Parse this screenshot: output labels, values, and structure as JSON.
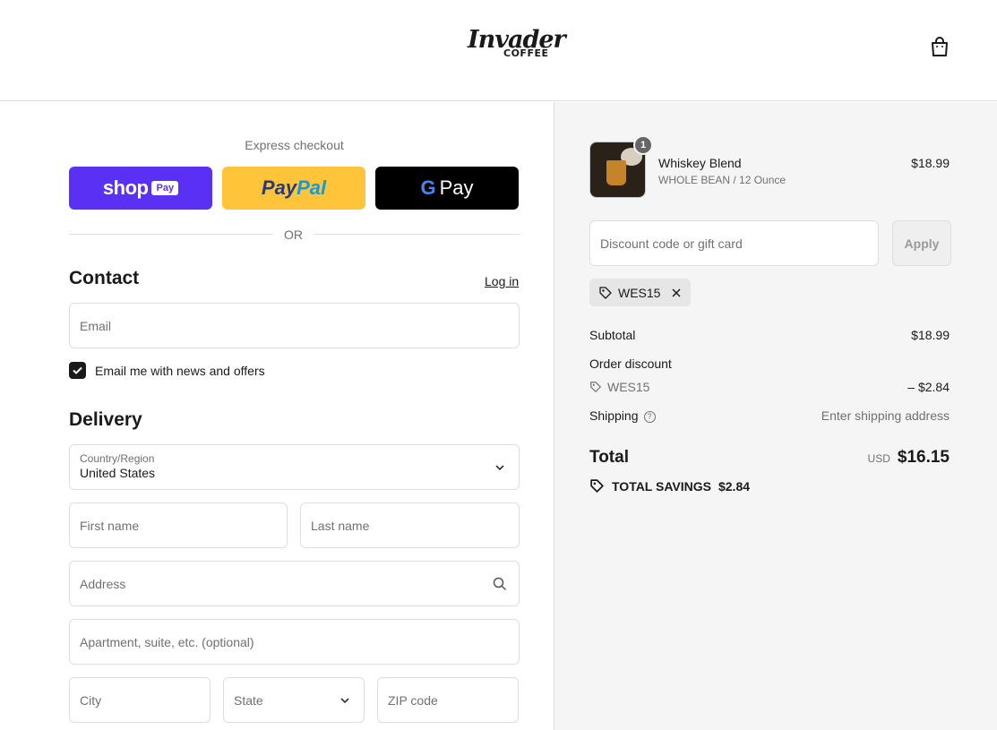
{
  "header": {
    "logo_main": "Invader",
    "logo_sub": "COFFEE",
    "cart_icon": "shopping-bag-icon"
  },
  "express": {
    "title": "Express checkout",
    "shop_pay": {
      "word": "shop",
      "badge": "Pay"
    },
    "paypal": {
      "a": "Pay",
      "b": "Pal"
    },
    "gpay": {
      "g": "G",
      "text": "Pay"
    },
    "or": "OR"
  },
  "contact": {
    "heading": "Contact",
    "login": "Log in",
    "email_placeholder": "Email",
    "newsletter_label": "Email me with news and offers",
    "newsletter_checked": true
  },
  "delivery": {
    "heading": "Delivery",
    "country_label": "Country/Region",
    "country_value": "United States",
    "first_name": "First name",
    "last_name": "Last name",
    "address": "Address",
    "apartment": "Apartment, suite, etc. (optional)",
    "city": "City",
    "state": "State",
    "zip": "ZIP code"
  },
  "summary": {
    "item": {
      "name": "Whiskey Blend",
      "variant": "WHOLE BEAN / 12 Ounce",
      "price": "$18.99",
      "quantity": "1"
    },
    "discount_placeholder": "Discount code or gift card",
    "apply_label": "Apply",
    "applied_code": "WES15",
    "subtotal_label": "Subtotal",
    "subtotal_value": "$18.99",
    "order_discount_label": "Order discount",
    "discount_code": "WES15",
    "discount_value": "– $2.84",
    "shipping_label": "Shipping",
    "shipping_value": "Enter shipping address",
    "total_label": "Total",
    "currency": "USD",
    "total_value": "$16.15",
    "savings_label": "TOTAL SAVINGS",
    "savings_value": "$2.84"
  }
}
